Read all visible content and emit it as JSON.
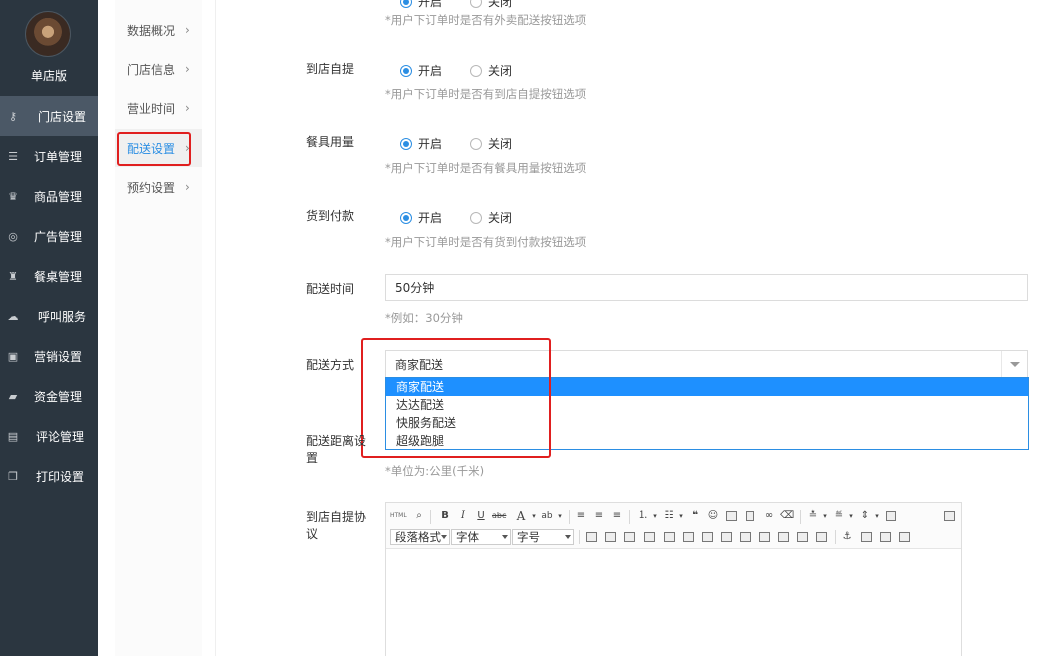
{
  "sidebar": {
    "shop_name": "单店版",
    "items": [
      {
        "label": "门店设置",
        "icon": "key-icon",
        "glyph": "⚷",
        "active": true
      },
      {
        "label": "订单管理",
        "icon": "list-icon",
        "glyph": "☰"
      },
      {
        "label": "商品管理",
        "icon": "trophy-icon",
        "glyph": "♛"
      },
      {
        "label": "广告管理",
        "icon": "lifebuoy-icon",
        "glyph": "◎"
      },
      {
        "label": "餐桌管理",
        "icon": "binoculars-icon",
        "glyph": "♜"
      },
      {
        "label": "呼叫服务",
        "icon": "cloud-icon",
        "glyph": "☁"
      },
      {
        "label": "营销设置",
        "icon": "gift-icon",
        "glyph": "▣"
      },
      {
        "label": "资金管理",
        "icon": "book-icon",
        "glyph": "▰"
      },
      {
        "label": "评论管理",
        "icon": "money-icon",
        "glyph": "▤"
      },
      {
        "label": "打印设置",
        "icon": "copy-icon",
        "glyph": "❐"
      }
    ]
  },
  "subnav": {
    "items": [
      {
        "label": "数据概况"
      },
      {
        "label": "门店信息"
      },
      {
        "label": "营业时间"
      },
      {
        "label": "配送设置",
        "active": true
      },
      {
        "label": "预约设置"
      }
    ],
    "arrow": "›"
  },
  "form": {
    "top_hint": "*用户下订单时是否有外卖配送按钮选项",
    "radio_on": "开启",
    "radio_off": "关闭",
    "self_pickup": {
      "label": "到店自提",
      "hint": "*用户下订单时是否有到店自提按钮选项"
    },
    "tableware": {
      "label": "餐具用量",
      "hint": "*用户下订单时是否有餐具用量按钮选项"
    },
    "cod": {
      "label": "货到付款",
      "hint": "*用户下订单时是否有货到付款按钮选项"
    },
    "delivery_time": {
      "label": "配送时间",
      "value": "50分钟",
      "hint": "*例如：30分钟"
    },
    "delivery_method": {
      "label": "配送方式",
      "selected": "商家配送",
      "options": [
        "商家配送",
        "达达配送",
        "快服务配送",
        "超级跑腿"
      ]
    },
    "delivery_distance": {
      "label": "配送距离设置",
      "hint": "*单位为:公里(千米)"
    },
    "pickup_agreement": {
      "label": "到店自提协议"
    }
  },
  "editor": {
    "html_btn": "HTML",
    "paragraph_format": "段落格式",
    "font_family": "字体",
    "font_size": "字号"
  },
  "colors": {
    "accent": "#2b8ee3",
    "sidebar_bg": "#2b3640",
    "highlight_red": "#e01f1f",
    "option_selected": "#1e90ff"
  }
}
